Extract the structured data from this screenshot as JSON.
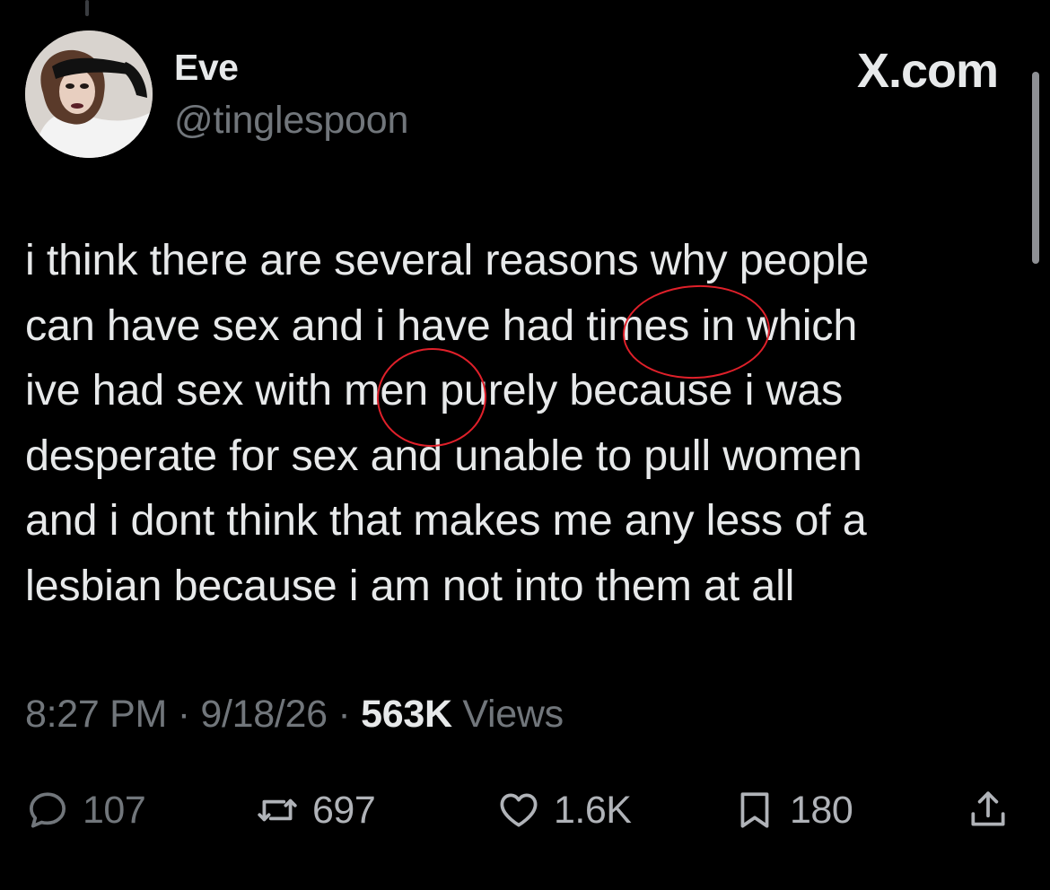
{
  "header": {
    "display_name": "Eve",
    "handle": "@tinglespoon",
    "brand": "X.com",
    "avatar_icon": "profile-photo"
  },
  "tweet": {
    "lines": [
      "i think there are several reasons why people",
      "can have sex and i have had times in which",
      "ive had sex with men purely because i was",
      "desperate for sex and unable to pull women",
      "and i dont think that makes me any less of a",
      "lesbian because i am not into them at all"
    ],
    "circled_words": [
      "times",
      "men"
    ],
    "circle_color": "#e0202a"
  },
  "meta": {
    "time": "8:27 PM",
    "sep1": "·",
    "date": "9/18/26",
    "sep2": "·",
    "views_count": "563K",
    "views_label": "Views"
  },
  "actions": {
    "reply": {
      "icon": "reply-icon",
      "count": "107"
    },
    "retweet": {
      "icon": "retweet-icon",
      "count": "697"
    },
    "like": {
      "icon": "heart-icon",
      "count": "1.6K"
    },
    "bookmark": {
      "icon": "bookmark-icon",
      "count": "180"
    },
    "share": {
      "icon": "share-icon"
    }
  },
  "colors": {
    "background": "#000000",
    "text": "#e7e9ea",
    "muted": "#71767b",
    "annotation": "#e0202a"
  }
}
